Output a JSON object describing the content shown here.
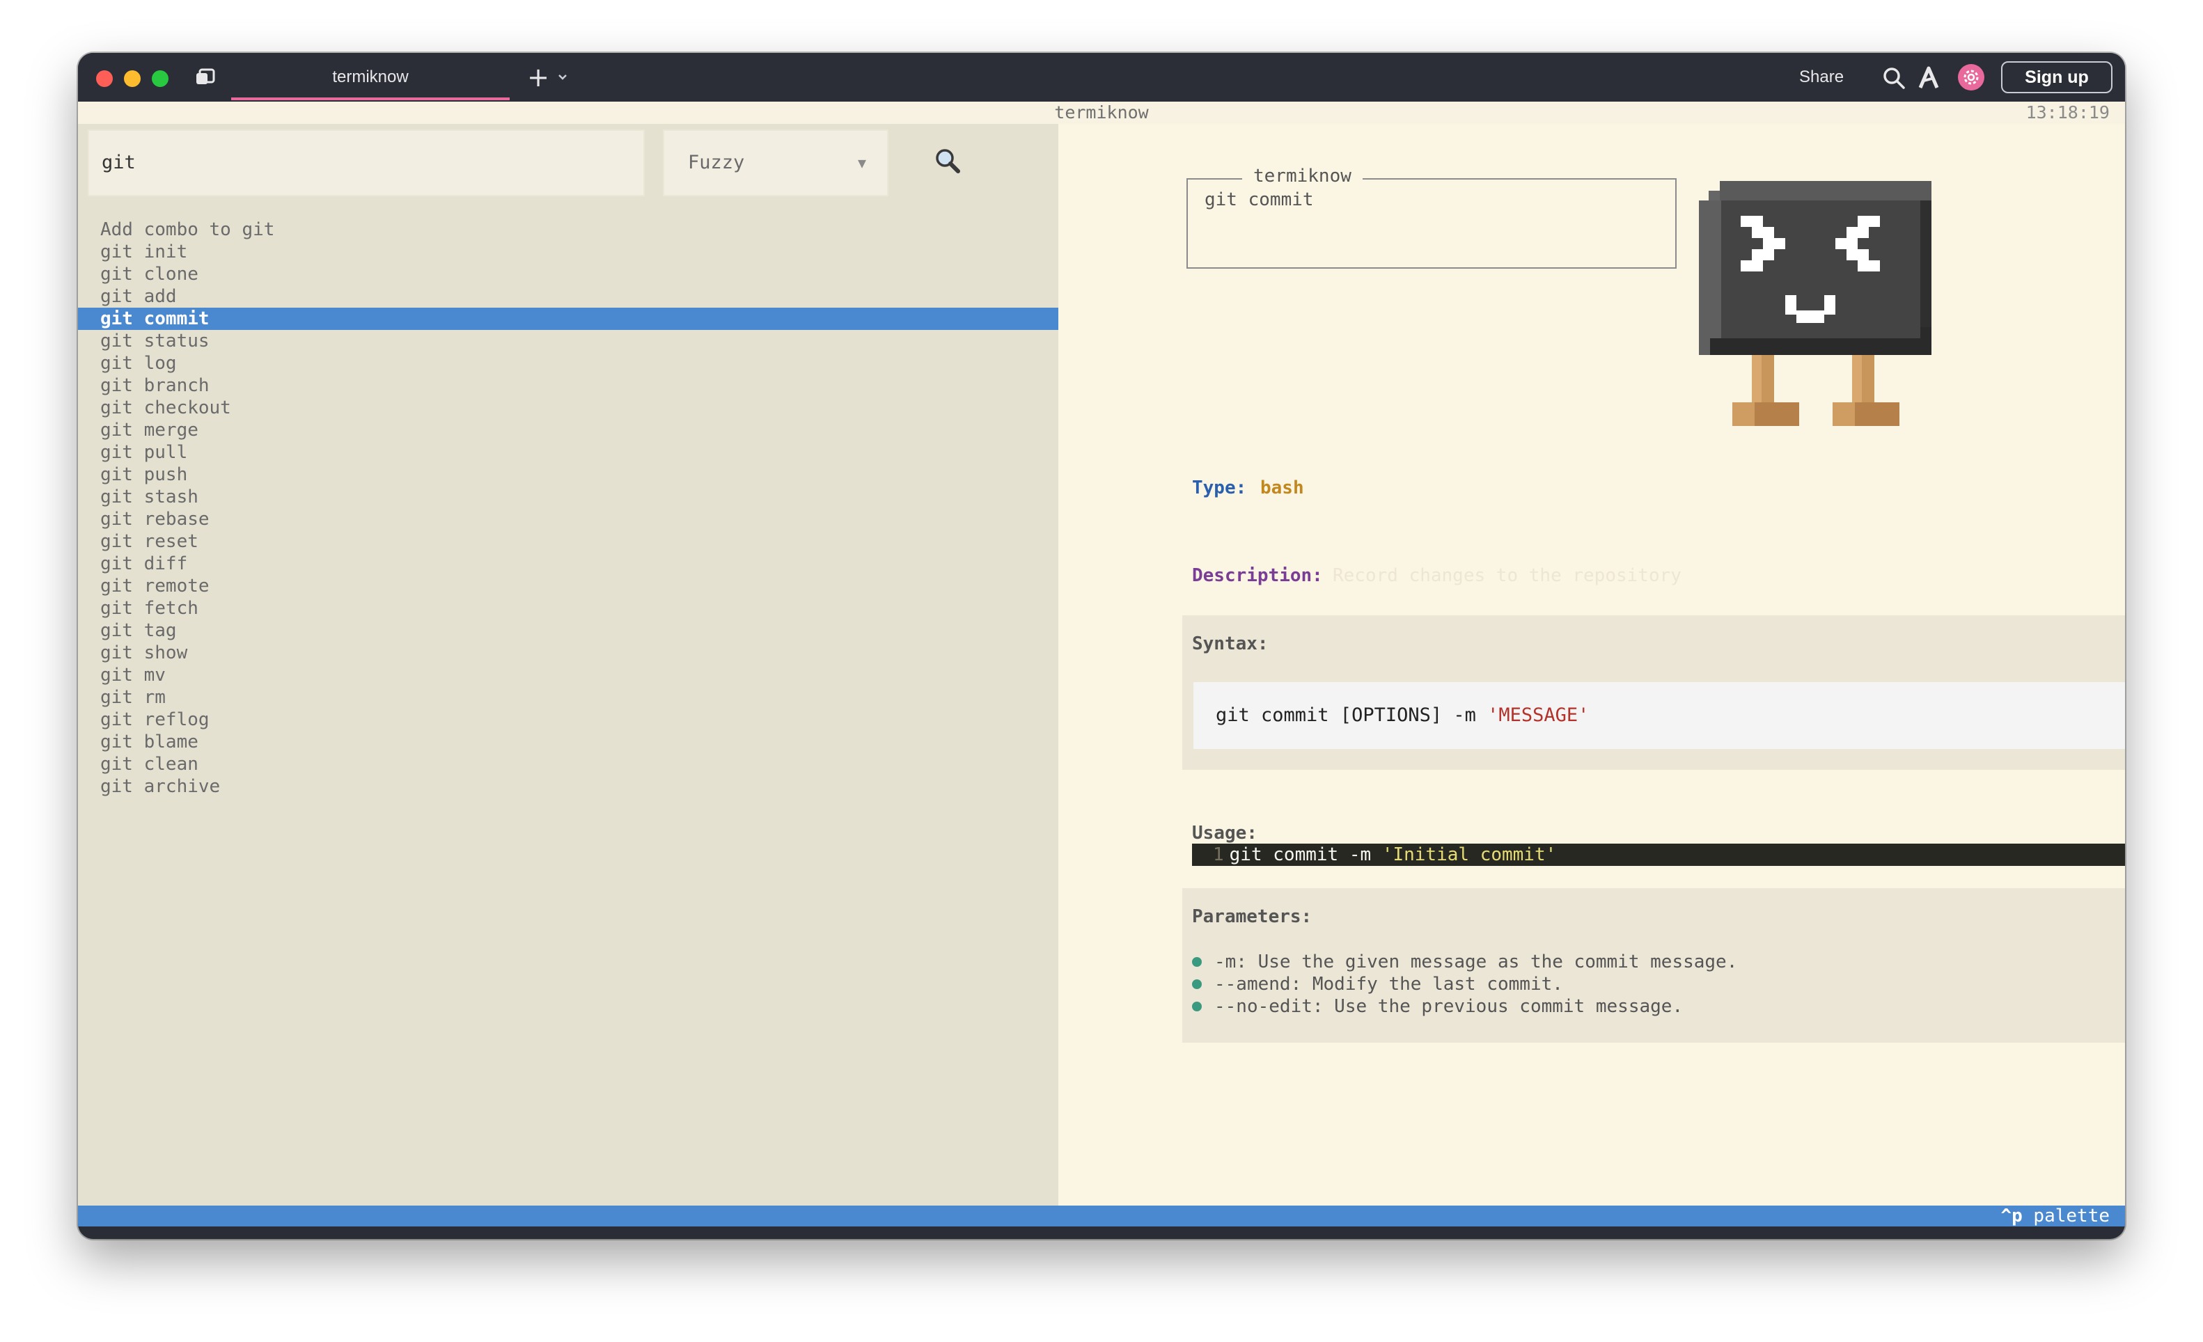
{
  "titlebar": {
    "tab_title": "termiknow",
    "new_tab_label": "+",
    "share_label": "Share",
    "signup_label": "Sign up"
  },
  "terminal": {
    "title": "termiknow",
    "clock": "13:18:19"
  },
  "search": {
    "query": "git",
    "mode": "Fuzzy"
  },
  "results": [
    "Add combo to git",
    "git init",
    "git clone",
    "git add",
    "git commit",
    "git status",
    "git log",
    "git branch",
    "git checkout",
    "git merge",
    "git pull",
    "git push",
    "git stash",
    "git rebase",
    "git reset",
    "git diff",
    "git remote",
    "git fetch",
    "git tag",
    "git show",
    "git mv",
    "git rm",
    "git reflog",
    "git blame",
    "git clean",
    "git archive"
  ],
  "selected_index": 4,
  "detail": {
    "box_title": "termiknow",
    "command": "git commit",
    "type_label": "Type:",
    "type_value": "bash",
    "description_label": "Description:",
    "description_value": "Record changes to the repository",
    "syntax_label": "Syntax:",
    "syntax_plain": "git commit [OPTIONS] -m ",
    "syntax_string": "'MESSAGE'",
    "usage_label": "Usage:",
    "usage_line_number": "1",
    "usage_plain": "git commit -m ",
    "usage_string": "'Initial commit'",
    "parameters_label": "Parameters:",
    "parameters": [
      "-m: Use the given message as the commit message.",
      "--amend: Modify the last commit.",
      "--no-edit: Use the previous commit message."
    ]
  },
  "statusbar": {
    "key": "^p",
    "action": "palette"
  },
  "colors": {
    "accent_pink": "#e9699c",
    "selection_blue": "#4a88cf",
    "type_blue": "#2a5fb0",
    "type_value_gold": "#c2881e",
    "description_purple": "#7a3d96",
    "string_red": "#b5322a",
    "bullet_green": "#3a9a80"
  },
  "icons": {
    "tabs": "tabs-icon",
    "dropdown": "chevron-down-icon",
    "search": "search-icon",
    "ai": "a-icon",
    "settings": "gear-icon",
    "magnifier": "magnifier-icon",
    "mascot": "mascot-icon"
  }
}
